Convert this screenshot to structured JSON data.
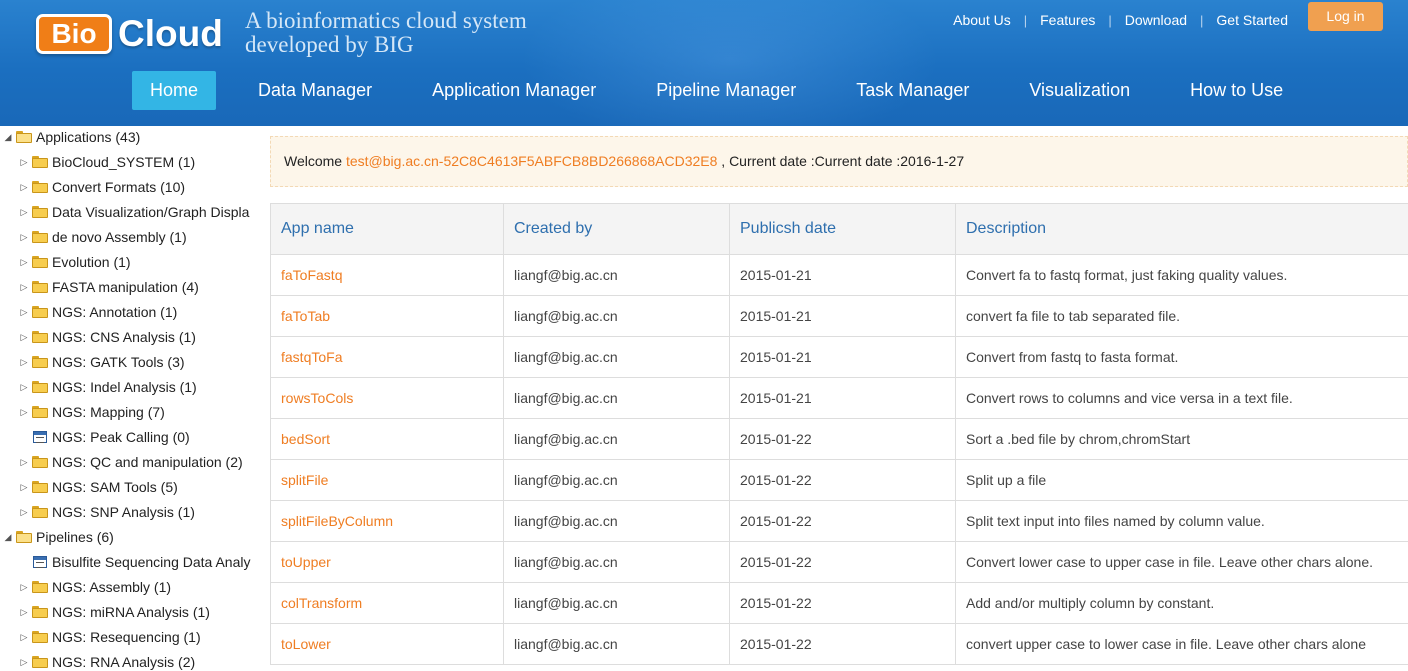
{
  "header": {
    "logo_bio": "Bio",
    "logo_cloud": "Cloud",
    "tagline": "A bioinformatics cloud system developed by BIG",
    "top_links": [
      "About Us",
      "Features",
      "Download",
      "Get Started"
    ],
    "separator": "|",
    "login_label": "Log in",
    "nav": [
      "Home",
      "Data Manager",
      "Application Manager",
      "Pipeline Manager",
      "Task Manager",
      "Visualization",
      "How to Use"
    ],
    "active_nav": "Home"
  },
  "sidebar": {
    "rows": [
      {
        "label": "Applications (43)",
        "level": 0,
        "icon": "folder-open-icon",
        "toggle": "expanded"
      },
      {
        "label": "BioCloud_SYSTEM (1)",
        "level": 1,
        "icon": "folder-icon",
        "toggle": "collapsed"
      },
      {
        "label": "Convert Formats (10)",
        "level": 1,
        "icon": "folder-icon",
        "toggle": "collapsed"
      },
      {
        "label": "Data Visualization/Graph Displa",
        "level": 1,
        "icon": "folder-icon",
        "toggle": "collapsed"
      },
      {
        "label": "de novo Assembly (1)",
        "level": 1,
        "icon": "folder-icon",
        "toggle": "collapsed"
      },
      {
        "label": "Evolution (1)",
        "level": 1,
        "icon": "folder-icon",
        "toggle": "collapsed"
      },
      {
        "label": "FASTA manipulation (4)",
        "level": 1,
        "icon": "folder-icon",
        "toggle": "collapsed"
      },
      {
        "label": "NGS: Annotation (1)",
        "level": 1,
        "icon": "folder-icon",
        "toggle": "collapsed"
      },
      {
        "label": "NGS: CNS Analysis (1)",
        "level": 1,
        "icon": "folder-icon",
        "toggle": "collapsed"
      },
      {
        "label": "NGS: GATK Tools (3)",
        "level": 1,
        "icon": "folder-icon",
        "toggle": "collapsed"
      },
      {
        "label": "NGS: Indel Analysis (1)",
        "level": 1,
        "icon": "folder-icon",
        "toggle": "collapsed"
      },
      {
        "label": "NGS: Mapping (7)",
        "level": 1,
        "icon": "folder-icon",
        "toggle": "collapsed"
      },
      {
        "label": "NGS: Peak Calling (0)",
        "level": 1,
        "icon": "app-icon",
        "toggle": "none"
      },
      {
        "label": "NGS: QC and manipulation (2)",
        "level": 1,
        "icon": "folder-icon",
        "toggle": "collapsed"
      },
      {
        "label": "NGS: SAM Tools (5)",
        "level": 1,
        "icon": "folder-icon",
        "toggle": "collapsed"
      },
      {
        "label": "NGS: SNP Analysis (1)",
        "level": 1,
        "icon": "folder-icon",
        "toggle": "collapsed"
      },
      {
        "label": "Pipelines (6)",
        "level": 0,
        "icon": "folder-open-icon",
        "toggle": "expanded"
      },
      {
        "label": "Bisulfite Sequencing Data Analy",
        "level": 1,
        "icon": "app-icon",
        "toggle": "none"
      },
      {
        "label": "NGS: Assembly (1)",
        "level": 1,
        "icon": "folder-icon",
        "toggle": "collapsed"
      },
      {
        "label": "NGS: miRNA Analysis (1)",
        "level": 1,
        "icon": "folder-icon",
        "toggle": "collapsed"
      },
      {
        "label": "NGS: Resequencing (1)",
        "level": 1,
        "icon": "folder-icon",
        "toggle": "collapsed"
      },
      {
        "label": "NGS: RNA Analysis (2)",
        "level": 1,
        "icon": "folder-icon",
        "toggle": "collapsed"
      }
    ]
  },
  "welcome": {
    "prefix": "Welcome ",
    "user": "test@big.ac.cn-52C8C4613F5ABFCB8BD266868ACD32E8",
    "date_text": " , Current date :Current date :2016-1-27"
  },
  "table": {
    "columns": [
      "App name",
      "Created by",
      "Publicsh date",
      "Description"
    ],
    "rows": [
      [
        "faToFastq",
        "liangf@big.ac.cn",
        "2015-01-21",
        "Convert fa to fastq format, just faking quality values."
      ],
      [
        "faToTab",
        "liangf@big.ac.cn",
        "2015-01-21",
        "convert fa file to tab separated file."
      ],
      [
        "fastqToFa",
        "liangf@big.ac.cn",
        "2015-01-21",
        "Convert from fastq to fasta format."
      ],
      [
        "rowsToCols",
        "liangf@big.ac.cn",
        "2015-01-21",
        "Convert rows to columns and vice versa in a text file."
      ],
      [
        "bedSort",
        "liangf@big.ac.cn",
        "2015-01-22",
        "Sort a .bed file by chrom,chromStart"
      ],
      [
        "splitFile",
        "liangf@big.ac.cn",
        "2015-01-22",
        "Split up a file"
      ],
      [
        "splitFileByColumn",
        "liangf@big.ac.cn",
        "2015-01-22",
        "Split text input into files named by column value."
      ],
      [
        "toUpper",
        "liangf@big.ac.cn",
        "2015-01-22",
        "Convert lower case to upper case in file. Leave other chars alone."
      ],
      [
        "colTransform",
        "liangf@big.ac.cn",
        "2015-01-22",
        "Add and/or multiply column by constant."
      ],
      [
        "toLower",
        "liangf@big.ac.cn",
        "2015-01-22",
        "convert upper case to lower case in file. Leave other chars alone"
      ]
    ]
  },
  "colors": {
    "header_blue": "#1b6fc0",
    "nav_active": "#33b5e5",
    "login_orange": "#f0a050",
    "link_orange": "#ef7d22",
    "table_header_text": "#2e6fae"
  }
}
